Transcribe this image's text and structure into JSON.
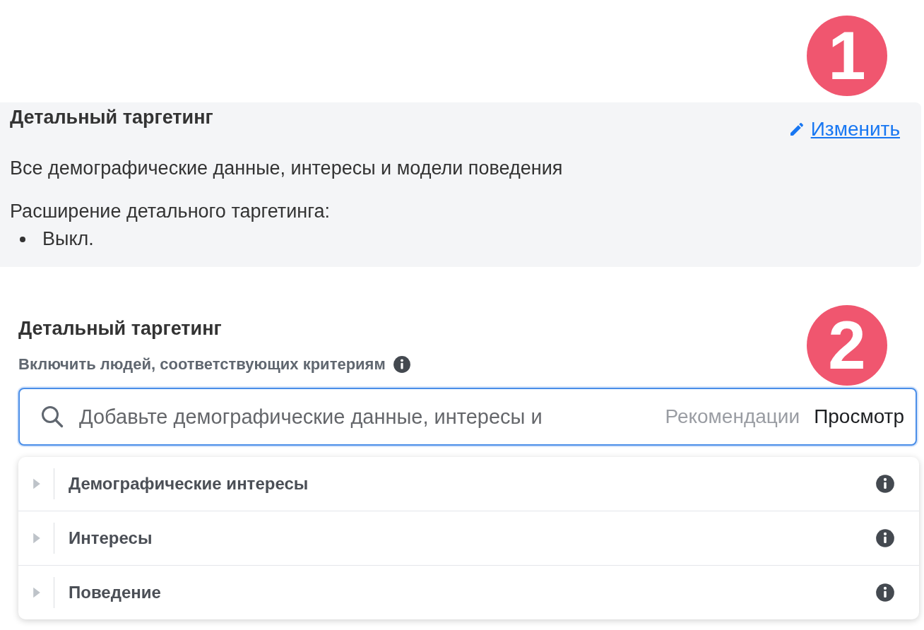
{
  "badges": [
    "1",
    "2"
  ],
  "summary": {
    "title": "Детальный таргетинг",
    "edit_link": "Изменить",
    "description": "Все демографические данные, интересы и модели поведения",
    "expansion_label": "Расширение детального таргетинга:",
    "expansion_items": [
      "Выкл."
    ]
  },
  "targeting": {
    "title": "Детальный таргетинг",
    "subtitle": "Включить людей, соответствующих критериям",
    "search": {
      "placeholder": "Добавьте демографические данные, интересы и",
      "suggestions": "Рекомендации",
      "browse": "Просмотр"
    },
    "categories": [
      {
        "label": "Демографические интересы",
        "expanded": false
      },
      {
        "label": "Интересы",
        "expanded": false
      },
      {
        "label": "Поведение",
        "expanded": false
      }
    ]
  }
}
